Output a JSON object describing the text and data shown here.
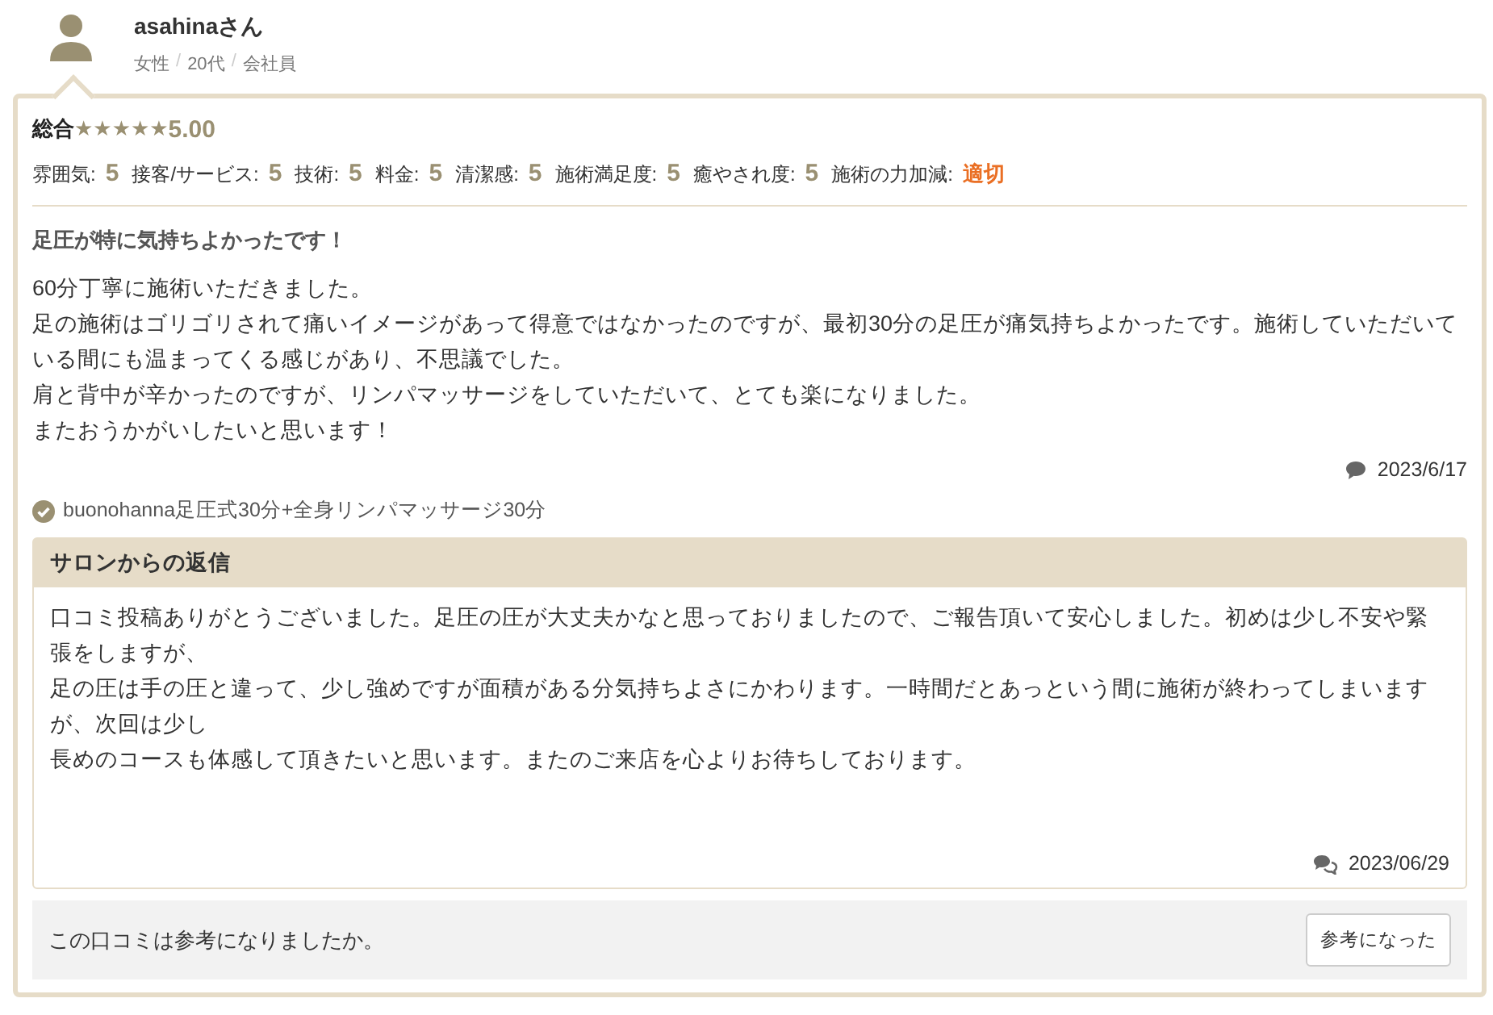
{
  "reviewer": {
    "name": "asahinaさん",
    "attributes": [
      "女性",
      "20代",
      "会社員"
    ],
    "separators": [
      "/",
      "/"
    ]
  },
  "overall": {
    "label": "総合",
    "stars": 5,
    "score": "5.00"
  },
  "ratings": [
    {
      "label": "雰囲気:",
      "value": "5",
      "kind": "number"
    },
    {
      "label": "接客/サービス:",
      "value": "5",
      "kind": "number"
    },
    {
      "label": "技術:",
      "value": "5",
      "kind": "number"
    },
    {
      "label": "料金:",
      "value": "5",
      "kind": "number"
    },
    {
      "label": "清潔感:",
      "value": "5",
      "kind": "number"
    },
    {
      "label": "施術満足度:",
      "value": "5",
      "kind": "number"
    },
    {
      "label": "癒やされ度:",
      "value": "5",
      "kind": "number"
    },
    {
      "label": "施術の力加減:",
      "value": "適切",
      "kind": "word"
    }
  ],
  "review": {
    "title": "足圧が特に気持ちよかったです！",
    "lines": [
      "60分丁寧に施術いただきました。",
      "足の施術はゴリゴリされて痛いイメージがあって得意ではなかったのですが、最初30分の足圧が痛気持ちよかったです。施術していただいている間にも温まってくる感じがあり、不思議でした。",
      "肩と背中が辛かったのですが、リンパマッサージをしていただいて、とても楽になりました。",
      "またおうかがいしたいと思います！"
    ],
    "date": "2023/6/17"
  },
  "menu": "buonohanna足圧式30分+全身リンパマッサージ30分",
  "reply": {
    "title": "サロンからの返信",
    "lines": [
      "口コミ投稿ありがとうございました。足圧の圧が大丈夫かなと思っておりましたので、ご報告頂いて安心しました。初めは少し不安や緊張をしますが、",
      "足の圧は手の圧と違って、少し強めですが面積がある分気持ちよさにかわります。一時間だとあっという間に施術が終わってしまいますが、次回は少し",
      "長めのコースも体感して頂きたいと思います。またのご来店を心よりお待ちしております。"
    ],
    "date": "2023/06/29"
  },
  "helpful": {
    "question": "この口コミは参考になりましたか。",
    "button": "参考になった"
  }
}
